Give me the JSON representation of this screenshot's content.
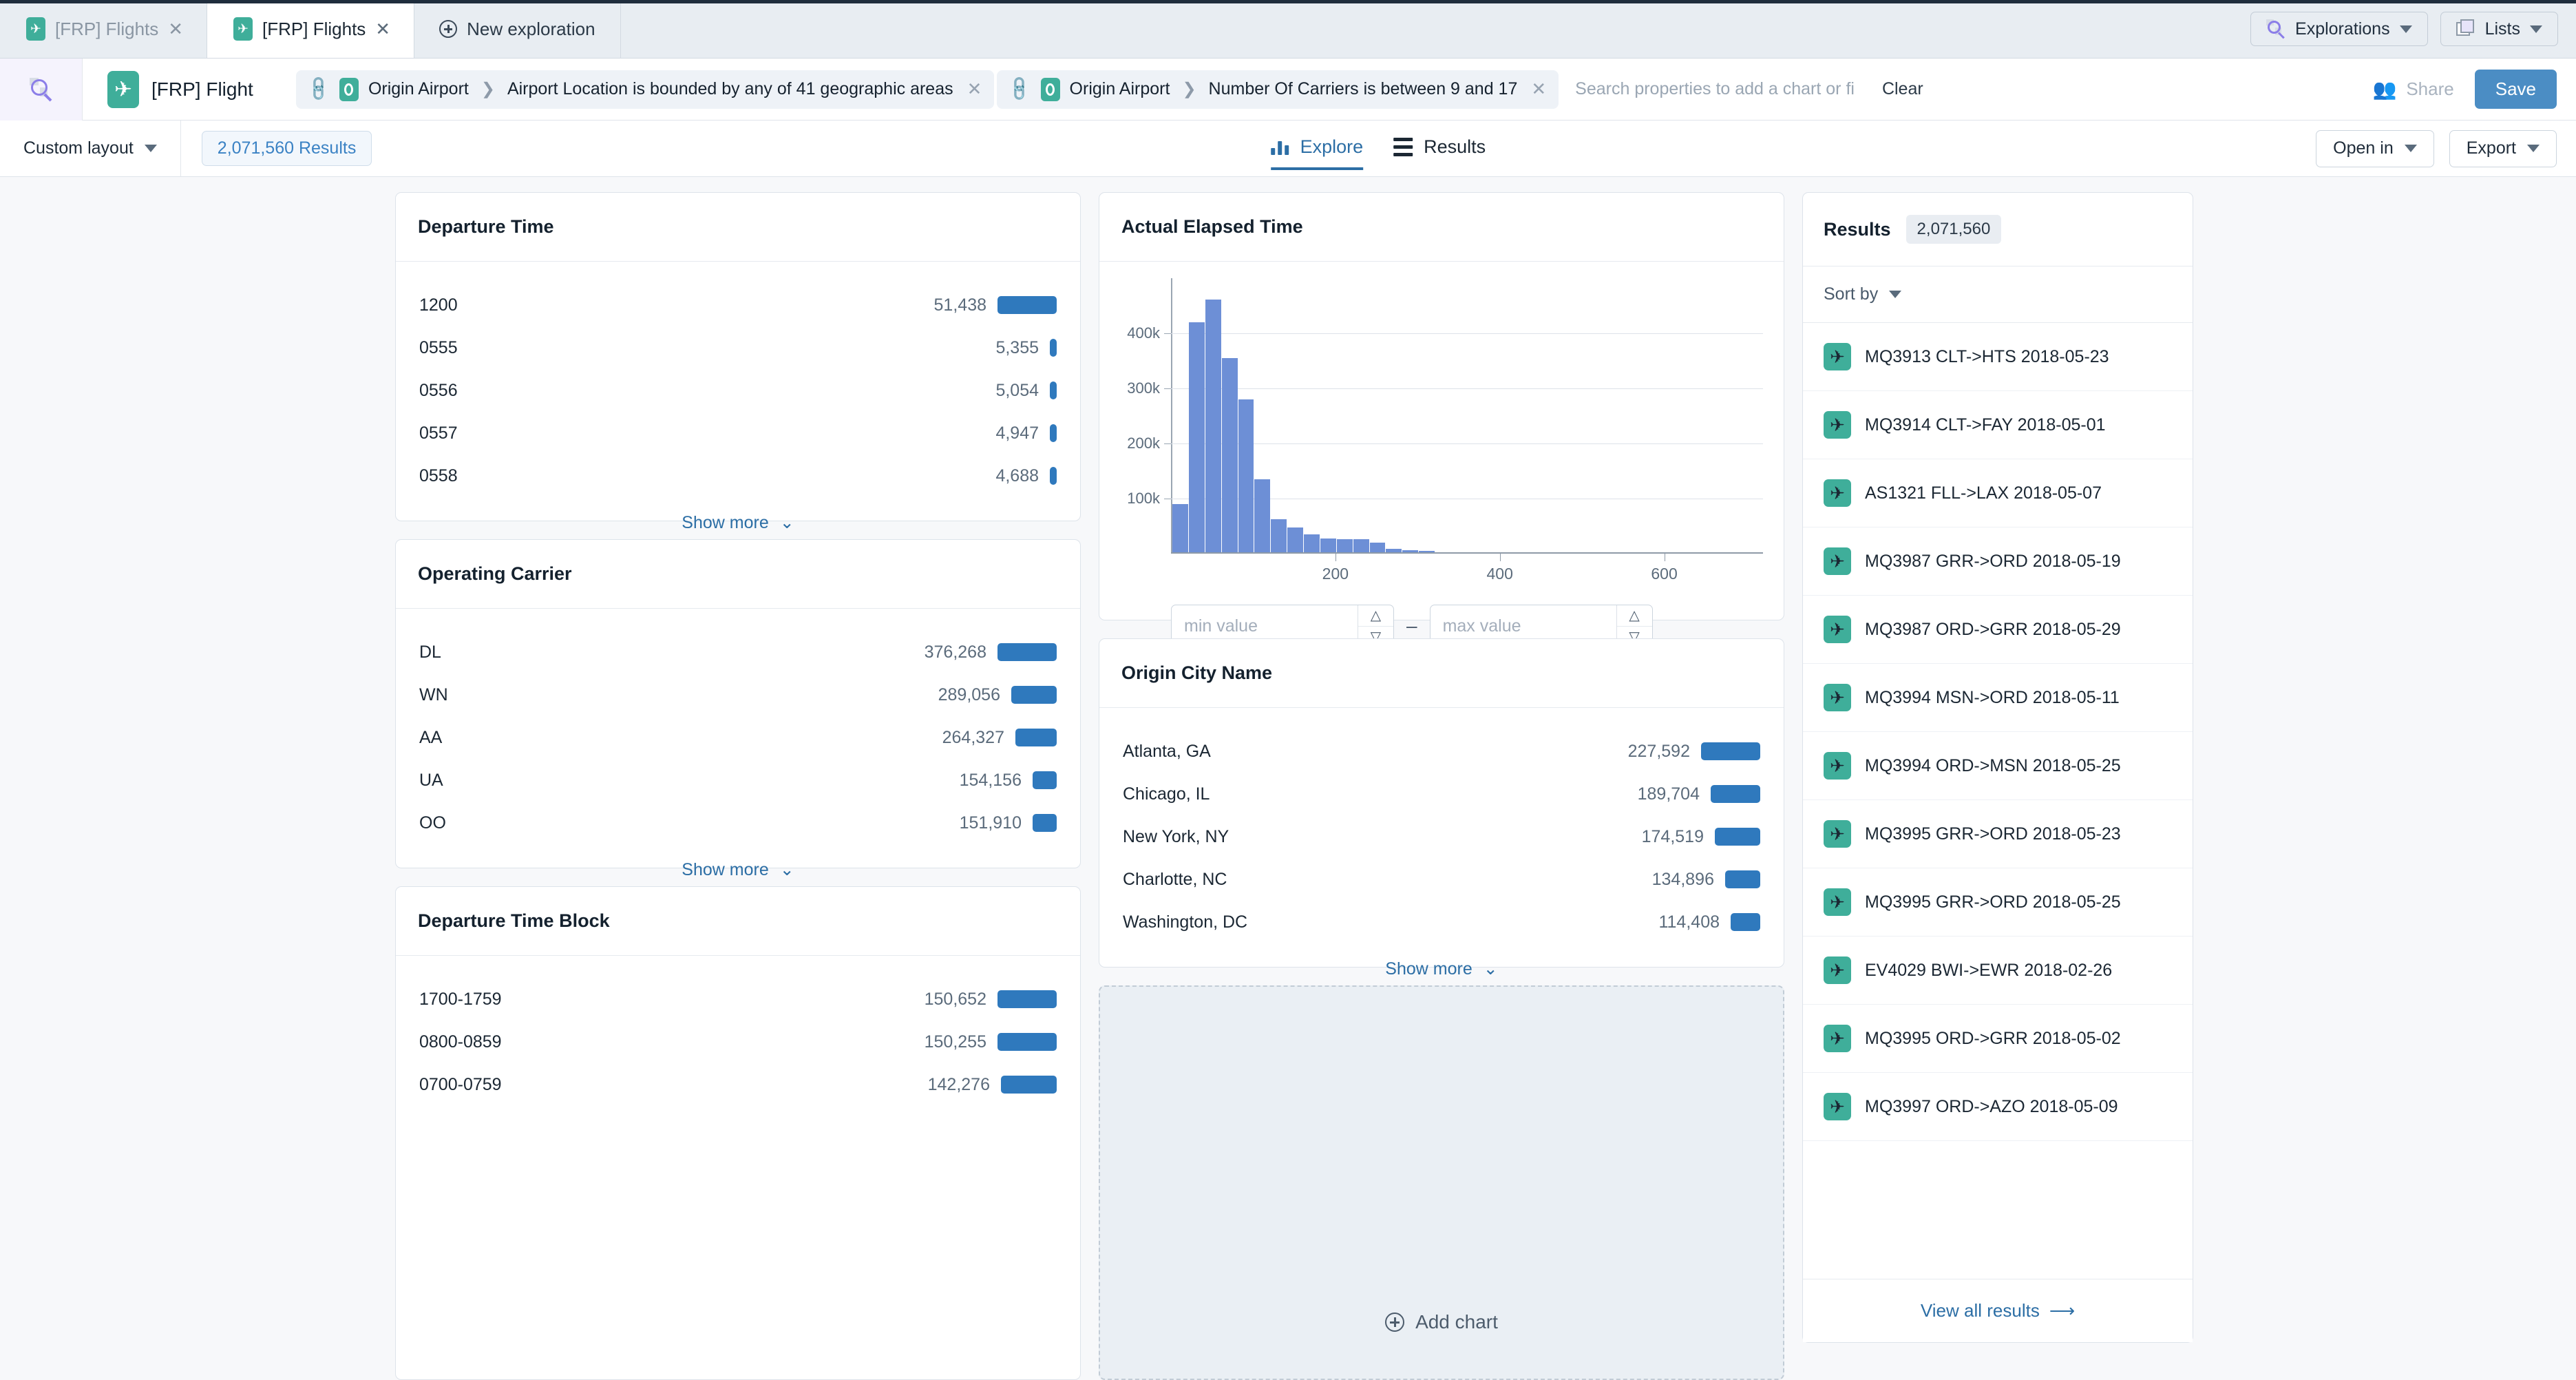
{
  "tabs": [
    {
      "label": "[FRP] Flights",
      "icon": "plane-icon",
      "close": "✕",
      "active": false
    },
    {
      "label": "[FRP] Flights",
      "icon": "plane-icon",
      "close": "✕",
      "active": true
    }
  ],
  "new_exploration_label": "New exploration",
  "top_right": {
    "explorations_label": "Explorations",
    "lists_label": "Lists"
  },
  "header": {
    "dataset_title": "[FRP] Flight",
    "filters": [
      {
        "object": "Origin Airport",
        "condition": "Airport Location is bounded by any of 41 geographic areas",
        "close": "✕"
      },
      {
        "object": "Origin Airport",
        "condition": "Number Of Carriers is between 9 and 17",
        "close": "✕"
      }
    ],
    "search_placeholder": "Search properties to add a chart or fi",
    "clear_label": "Clear",
    "share_label": "Share",
    "save_label": "Save"
  },
  "toolbar": {
    "layout_label": "Custom layout",
    "results_pill": "2,071,560 Results",
    "tabs": [
      {
        "label": "Explore",
        "icon": "bar-chart-icon",
        "selected": true
      },
      {
        "label": "Results",
        "icon": "list-icon",
        "selected": false
      }
    ],
    "open_in_label": "Open in",
    "export_label": "Export"
  },
  "cards": {
    "departure_time": {
      "title": "Departure Time",
      "show_more": "Show more",
      "rows": [
        {
          "label": "1200",
          "value": "51,438",
          "n": 51438
        },
        {
          "label": "0555",
          "value": "5,355",
          "n": 5355
        },
        {
          "label": "0556",
          "value": "5,054",
          "n": 5054
        },
        {
          "label": "0557",
          "value": "4,947",
          "n": 4947
        },
        {
          "label": "0558",
          "value": "4,688",
          "n": 4688
        }
      ]
    },
    "operating_carrier": {
      "title": "Operating Carrier",
      "show_more": "Show more",
      "rows": [
        {
          "label": "DL",
          "value": "376,268",
          "n": 376268
        },
        {
          "label": "WN",
          "value": "289,056",
          "n": 289056
        },
        {
          "label": "AA",
          "value": "264,327",
          "n": 264327
        },
        {
          "label": "UA",
          "value": "154,156",
          "n": 154156
        },
        {
          "label": "OO",
          "value": "151,910",
          "n": 151910
        }
      ]
    },
    "departure_time_block": {
      "title": "Departure Time Block",
      "rows": [
        {
          "label": "1700-1759",
          "value": "150,652",
          "n": 150652
        },
        {
          "label": "0800-0859",
          "value": "150,255",
          "n": 150255
        },
        {
          "label": "0700-0759",
          "value": "142,276",
          "n": 142276
        }
      ]
    },
    "origin_city_name": {
      "title": "Origin City Name",
      "show_more": "Show more",
      "rows": [
        {
          "label": "Atlanta, GA",
          "value": "227,592",
          "n": 227592
        },
        {
          "label": "Chicago, IL",
          "value": "189,704",
          "n": 189704
        },
        {
          "label": "New York, NY",
          "value": "174,519",
          "n": 174519
        },
        {
          "label": "Charlotte, NC",
          "value": "134,896",
          "n": 134896
        },
        {
          "label": "Washington, DC",
          "value": "114,408",
          "n": 114408
        }
      ]
    },
    "actual_elapsed_time": {
      "title": "Actual Elapsed Time",
      "min_placeholder": "min value",
      "max_placeholder": "max value",
      "min_value": "",
      "max_value": "",
      "dash": "–"
    },
    "add_chart_label": "Add chart"
  },
  "chart_data": {
    "type": "bar",
    "title": "Actual Elapsed Time",
    "xlabel": "",
    "ylabel": "",
    "xlim": [
      0,
      700
    ],
    "ylim": [
      0,
      500000
    ],
    "grid": true,
    "ytick_labels": [
      "100k",
      "200k",
      "300k",
      "400k"
    ],
    "ytick_values": [
      100000,
      200000,
      300000,
      400000
    ],
    "xtick_labels": [
      "200",
      "400",
      "600"
    ],
    "xtick_values": [
      200,
      400,
      600
    ],
    "bin_width": 20,
    "bin_starts": [
      20,
      40,
      60,
      80,
      100,
      120,
      140,
      160,
      180,
      200,
      220,
      240,
      260,
      280,
      300,
      320,
      340,
      360,
      380,
      400
    ],
    "values": [
      88000,
      418000,
      459000,
      352000,
      278000,
      133000,
      60000,
      45000,
      33000,
      25000,
      24000,
      24000,
      17000,
      6000,
      3500,
      3000,
      0,
      0,
      0,
      0
    ]
  },
  "results_panel": {
    "title": "Results",
    "count": "2,071,560",
    "sort_label": "Sort by",
    "view_all_label": "View all results",
    "items": [
      {
        "label": "MQ3913 CLT->HTS 2018-05-23"
      },
      {
        "label": "MQ3914 CLT->FAY 2018-05-01"
      },
      {
        "label": "AS1321 FLL->LAX 2018-05-07"
      },
      {
        "label": "MQ3987 GRR->ORD 2018-05-19"
      },
      {
        "label": "MQ3987 ORD->GRR 2018-05-29"
      },
      {
        "label": "MQ3994 MSN->ORD 2018-05-11"
      },
      {
        "label": "MQ3994 ORD->MSN 2018-05-25"
      },
      {
        "label": "MQ3995 GRR->ORD 2018-05-23"
      },
      {
        "label": "MQ3995 GRR->ORD 2018-05-25"
      },
      {
        "label": "EV4029 BWI->EWR 2018-02-26"
      },
      {
        "label": "MQ3995 ORD->GRR 2018-05-02"
      },
      {
        "label": "MQ3997 ORD->AZO 2018-05-09"
      }
    ]
  },
  "colors": {
    "accent_blue": "#2f79bd",
    "link_blue": "#2c6ea5",
    "histogram_bar": "#6d8fd6",
    "teal": "#3fae9a",
    "save_button": "#4b8dc4"
  }
}
